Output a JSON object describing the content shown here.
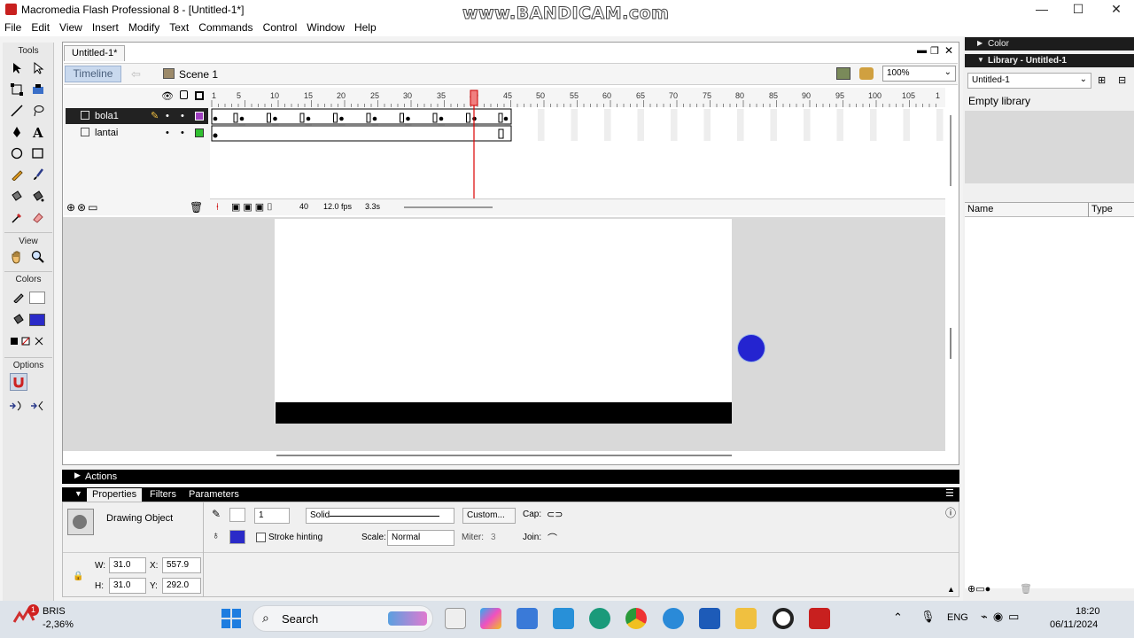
{
  "window": {
    "title": "Macromedia Flash Professional 8 - [Untitled-1*]",
    "minimize": "—",
    "maximize": "☐",
    "close": "✕"
  },
  "watermark": "www.BANDICAM.com",
  "menu": [
    "File",
    "Edit",
    "View",
    "Insert",
    "Modify",
    "Text",
    "Commands",
    "Control",
    "Window",
    "Help"
  ],
  "tools": {
    "header": "Tools",
    "view_header": "View",
    "colors_header": "Colors",
    "options_header": "Options"
  },
  "document": {
    "tab": "Untitled-1*",
    "timeline_btn": "Timeline",
    "scene": "Scene 1",
    "zoom": "100%"
  },
  "timeline": {
    "ruler": [
      "1",
      "5",
      "10",
      "15",
      "20",
      "25",
      "30",
      "35",
      "40",
      "45",
      "50",
      "55",
      "60",
      "65",
      "70",
      "75",
      "80",
      "85",
      "90",
      "95",
      "100",
      "105",
      "1"
    ],
    "layers": [
      {
        "name": "bola1",
        "color": "#a040c0",
        "selected": true
      },
      {
        "name": "lantai",
        "color": "#30c030",
        "selected": false
      }
    ],
    "current_frame": "40",
    "fps": "12.0 fps",
    "time": "3.3s"
  },
  "panels": {
    "actions": "Actions",
    "tabs": [
      "Properties",
      "Filters",
      "Parameters"
    ],
    "props": {
      "object": "Drawing Object",
      "stroke_width": "1",
      "stroke_style": "Solid",
      "custom": "Custom...",
      "cap": "Cap:",
      "stroke_hinting": "Stroke hinting",
      "scale_label": "Scale:",
      "scale": "Normal",
      "miter_label": "Miter:",
      "miter": "3",
      "join": "Join:",
      "w_label": "W:",
      "w": "31.0",
      "h_label": "H:",
      "h": "31.0",
      "x_label": "X:",
      "x": "557.9",
      "y_label": "Y:",
      "y": "292.0",
      "fill_color": "#2a2ac8"
    }
  },
  "right": {
    "color_hdr": "Color",
    "library_hdr": "Library - Untitled-1",
    "lib_select": "Untitled-1",
    "empty": "Empty library",
    "col_name": "Name",
    "col_type": "Type"
  },
  "taskbar": {
    "stock_name": "BRIS",
    "stock_change": "-2,36%",
    "badge": "1",
    "search": "Search",
    "lang": "ENG",
    "time": "18:20",
    "date": "06/11/2024"
  },
  "colors": {
    "ball": "#2424d0",
    "floor": "#000000",
    "accent": "#c9d9ee"
  }
}
